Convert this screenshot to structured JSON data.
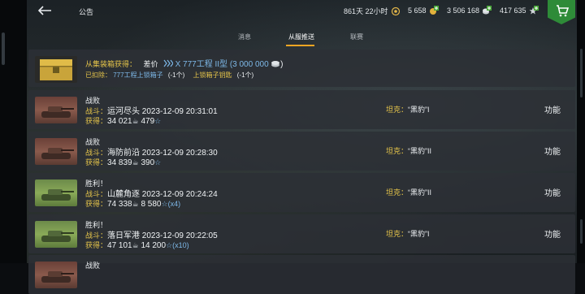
{
  "header": {
    "title": "公告",
    "timer": "861天 22小时",
    "gold": "5 658",
    "credits": "3 506 168",
    "free_xp": "417 635"
  },
  "tabs": [
    {
      "label": "消息",
      "active": false
    },
    {
      "label": "从服推送",
      "active": true
    },
    {
      "label": "联赛",
      "active": false
    }
  ],
  "chest": {
    "from_label": "从集装箱获得：",
    "reward_label": "差价",
    "reward_value": "X 777工程 II型 (3 000 000",
    "deduct_label": "已扣除：",
    "deduct_item": "777工程上锁箱子",
    "deduct_count": "(-1个)",
    "key_item": "上锁箱子钥匙",
    "key_count": "(-1个)"
  },
  "battles": [
    {
      "result": "战败",
      "result_kind": "defeat",
      "battle_label": "战斗：",
      "map": "运河尽头",
      "time": "2023-12-09 20:31:01",
      "earn_label": "获得：",
      "credits": "34 021",
      "xp": "479",
      "mult": "",
      "tank_label": "坦克：",
      "tank": "“黑豹”I",
      "func": "功能"
    },
    {
      "result": "战败",
      "result_kind": "defeat",
      "battle_label": "战斗：",
      "map": "海防前沿",
      "time": "2023-12-09 20:28:30",
      "earn_label": "获得：",
      "credits": "34 839",
      "xp": "390",
      "mult": "",
      "tank_label": "坦克：",
      "tank": "“黑豹”II",
      "func": "功能"
    },
    {
      "result": "胜利！",
      "result_kind": "win",
      "battle_label": "战斗：",
      "map": "山麓角逐",
      "time": "2023-12-09 20:24:24",
      "earn_label": "获得：",
      "credits": "74 338",
      "xp": "8 580",
      "mult": "(x4)",
      "tank_label": "坦克：",
      "tank": "“黑豹”II",
      "func": "功能"
    },
    {
      "result": "胜利！",
      "result_kind": "win",
      "battle_label": "战斗：",
      "map": "落日军港",
      "time": "2023-12-09 20:22:05",
      "earn_label": "获得：",
      "credits": "47 101",
      "xp": "14 200",
      "mult": "(x10)",
      "tank_label": "坦克：",
      "tank": "“黑豹”I",
      "func": "功能"
    },
    {
      "result": "战败",
      "result_kind": "defeat"
    }
  ]
}
